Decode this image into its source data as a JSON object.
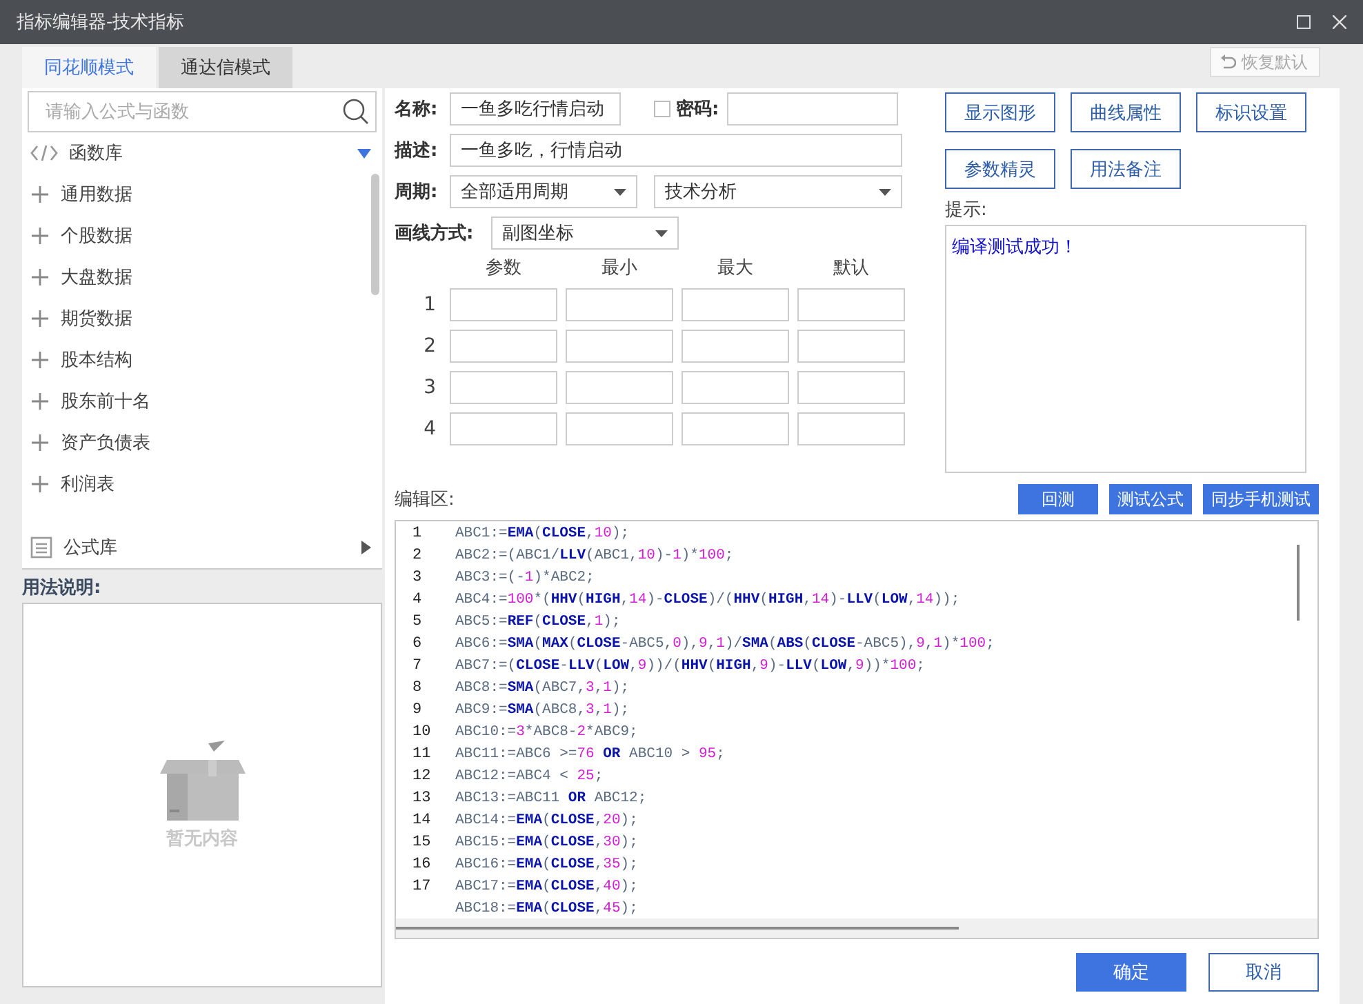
{
  "window": {
    "title": "指标编辑器-技术指标"
  },
  "tabs": [
    {
      "label": "同花顺模式",
      "selected": true
    },
    {
      "label": "通达信模式",
      "selected": false
    }
  ],
  "search": {
    "placeholder": "请输入公式与函数"
  },
  "libraries": [
    {
      "label": "函数库",
      "kind": "code",
      "expanded": true,
      "items": [
        {
          "label": "通用数据",
          "expanded": false
        },
        {
          "label": "个股数据",
          "expanded": false
        },
        {
          "label": "大盘数据",
          "expanded": false
        },
        {
          "label": "期货数据",
          "expanded": false
        },
        {
          "label": "股本结构",
          "expanded": false
        },
        {
          "label": "股东前十名",
          "expanded": false
        },
        {
          "label": "资产负债表",
          "expanded": false
        },
        {
          "label": "利润表",
          "expanded": false
        }
      ]
    },
    {
      "label": "公式库",
      "kind": "list",
      "expanded": false
    }
  ],
  "usage": {
    "label": "用法说明:",
    "empty_text": "暂无内容"
  },
  "restore_button": {
    "label": "恢复默认",
    "disabled": true
  },
  "form": {
    "name": {
      "label": "名称:",
      "value": "一鱼多吃行情启动"
    },
    "password": {
      "label": "密码:",
      "checked": false
    },
    "description": {
      "label": "描述:",
      "value": "一鱼多吃，行情启动"
    },
    "period": {
      "label": "周期:",
      "value": "全部适用周期"
    },
    "category": {
      "value": "技术分析"
    },
    "draw_mode": {
      "label": "画线方式:",
      "value": "副图坐标"
    }
  },
  "params": {
    "columns": [
      "参数",
      "最小",
      "最大",
      "默认"
    ],
    "rows": [
      "1",
      "2",
      "3",
      "4"
    ]
  },
  "side_buttons": [
    "显示图形",
    "曲线属性",
    "标识设置",
    "参数精灵",
    "用法备注"
  ],
  "hint": {
    "label": "提示:",
    "text": "编译测试成功！"
  },
  "editor": {
    "label": "编辑区:",
    "buttons": [
      "回测",
      "测试公式",
      "同步手机测试"
    ],
    "lines": [
      {
        "number": "1",
        "tokens": [
          {
            "text": "ABC1:=",
            "kind": "p"
          },
          {
            "text": "EMA",
            "kind": "f"
          },
          {
            "text": "(",
            "kind": "p"
          },
          {
            "text": "CLOSE",
            "kind": "f"
          },
          {
            "text": ",",
            "kind": "p"
          },
          {
            "text": "10",
            "kind": "n"
          },
          {
            "text": ");",
            "kind": "p"
          }
        ]
      },
      {
        "number": "2",
        "tokens": [
          {
            "text": "ABC2:=(ABC1/",
            "kind": "p"
          },
          {
            "text": "LLV",
            "kind": "f"
          },
          {
            "text": "(ABC1,",
            "kind": "p"
          },
          {
            "text": "10",
            "kind": "n"
          },
          {
            "text": ")-",
            "kind": "p"
          },
          {
            "text": "1",
            "kind": "n"
          },
          {
            "text": ")*",
            "kind": "p"
          },
          {
            "text": "100",
            "kind": "n"
          },
          {
            "text": ";",
            "kind": "p"
          }
        ]
      },
      {
        "number": "3",
        "tokens": [
          {
            "text": "ABC3:=(-",
            "kind": "p"
          },
          {
            "text": "1",
            "kind": "n"
          },
          {
            "text": ")*ABC2;",
            "kind": "p"
          }
        ]
      },
      {
        "number": "4",
        "tokens": [
          {
            "text": "ABC4:=",
            "kind": "p"
          },
          {
            "text": "100",
            "kind": "n"
          },
          {
            "text": "*(",
            "kind": "p"
          },
          {
            "text": "HHV",
            "kind": "f"
          },
          {
            "text": "(",
            "kind": "p"
          },
          {
            "text": "HIGH",
            "kind": "f"
          },
          {
            "text": ",",
            "kind": "p"
          },
          {
            "text": "14",
            "kind": "n"
          },
          {
            "text": ")-",
            "kind": "p"
          },
          {
            "text": "CLOSE",
            "kind": "f"
          },
          {
            "text": ")/(",
            "kind": "p"
          },
          {
            "text": "HHV",
            "kind": "f"
          },
          {
            "text": "(",
            "kind": "p"
          },
          {
            "text": "HIGH",
            "kind": "f"
          },
          {
            "text": ",",
            "kind": "p"
          },
          {
            "text": "14",
            "kind": "n"
          },
          {
            "text": ")-",
            "kind": "p"
          },
          {
            "text": "LLV",
            "kind": "f"
          },
          {
            "text": "(",
            "kind": "p"
          },
          {
            "text": "LOW",
            "kind": "f"
          },
          {
            "text": ",",
            "kind": "p"
          },
          {
            "text": "14",
            "kind": "n"
          },
          {
            "text": "));",
            "kind": "p"
          }
        ]
      },
      {
        "number": "5",
        "tokens": [
          {
            "text": "ABC5:=",
            "kind": "p"
          },
          {
            "text": "REF",
            "kind": "f"
          },
          {
            "text": "(",
            "kind": "p"
          },
          {
            "text": "CLOSE",
            "kind": "f"
          },
          {
            "text": ",",
            "kind": "p"
          },
          {
            "text": "1",
            "kind": "n"
          },
          {
            "text": ");",
            "kind": "p"
          }
        ]
      },
      {
        "number": "6",
        "tokens": [
          {
            "text": "ABC6:=",
            "kind": "p"
          },
          {
            "text": "SMA",
            "kind": "f"
          },
          {
            "text": "(",
            "kind": "p"
          },
          {
            "text": "MAX",
            "kind": "f"
          },
          {
            "text": "(",
            "kind": "p"
          },
          {
            "text": "CLOSE",
            "kind": "f"
          },
          {
            "text": "-ABC5,",
            "kind": "p"
          },
          {
            "text": "0",
            "kind": "n"
          },
          {
            "text": "),",
            "kind": "p"
          },
          {
            "text": "9",
            "kind": "n"
          },
          {
            "text": ",",
            "kind": "p"
          },
          {
            "text": "1",
            "kind": "n"
          },
          {
            "text": ")/",
            "kind": "p"
          },
          {
            "text": "SMA",
            "kind": "f"
          },
          {
            "text": "(",
            "kind": "p"
          },
          {
            "text": "ABS",
            "kind": "f"
          },
          {
            "text": "(",
            "kind": "p"
          },
          {
            "text": "CLOSE",
            "kind": "f"
          },
          {
            "text": "-ABC5),",
            "kind": "p"
          },
          {
            "text": "9",
            "kind": "n"
          },
          {
            "text": ",",
            "kind": "p"
          },
          {
            "text": "1",
            "kind": "n"
          },
          {
            "text": ")*",
            "kind": "p"
          },
          {
            "text": "100",
            "kind": "n"
          },
          {
            "text": ";",
            "kind": "p"
          }
        ]
      },
      {
        "number": "7",
        "tokens": [
          {
            "text": "ABC7:=(",
            "kind": "p"
          },
          {
            "text": "CLOSE",
            "kind": "f"
          },
          {
            "text": "-",
            "kind": "p"
          },
          {
            "text": "LLV",
            "kind": "f"
          },
          {
            "text": "(",
            "kind": "p"
          },
          {
            "text": "LOW",
            "kind": "f"
          },
          {
            "text": ",",
            "kind": "p"
          },
          {
            "text": "9",
            "kind": "n"
          },
          {
            "text": "))/(",
            "kind": "p"
          },
          {
            "text": "HHV",
            "kind": "f"
          },
          {
            "text": "(",
            "kind": "p"
          },
          {
            "text": "HIGH",
            "kind": "f"
          },
          {
            "text": ",",
            "kind": "p"
          },
          {
            "text": "9",
            "kind": "n"
          },
          {
            "text": ")-",
            "kind": "p"
          },
          {
            "text": "LLV",
            "kind": "f"
          },
          {
            "text": "(",
            "kind": "p"
          },
          {
            "text": "LOW",
            "kind": "f"
          },
          {
            "text": ",",
            "kind": "p"
          },
          {
            "text": "9",
            "kind": "n"
          },
          {
            "text": "))*",
            "kind": "p"
          },
          {
            "text": "100",
            "kind": "n"
          },
          {
            "text": ";",
            "kind": "p"
          }
        ]
      },
      {
        "number": "8",
        "tokens": [
          {
            "text": "ABC8:=",
            "kind": "p"
          },
          {
            "text": "SMA",
            "kind": "f"
          },
          {
            "text": "(ABC7,",
            "kind": "p"
          },
          {
            "text": "3",
            "kind": "n"
          },
          {
            "text": ",",
            "kind": "p"
          },
          {
            "text": "1",
            "kind": "n"
          },
          {
            "text": ");",
            "kind": "p"
          }
        ]
      },
      {
        "number": "9",
        "tokens": [
          {
            "text": "ABC9:=",
            "kind": "p"
          },
          {
            "text": "SMA",
            "kind": "f"
          },
          {
            "text": "(ABC8,",
            "kind": "p"
          },
          {
            "text": "3",
            "kind": "n"
          },
          {
            "text": ",",
            "kind": "p"
          },
          {
            "text": "1",
            "kind": "n"
          },
          {
            "text": ");",
            "kind": "p"
          }
        ]
      },
      {
        "number": "10",
        "tokens": [
          {
            "text": "ABC10:=",
            "kind": "p"
          },
          {
            "text": "3",
            "kind": "n"
          },
          {
            "text": "*ABC8-",
            "kind": "p"
          },
          {
            "text": "2",
            "kind": "n"
          },
          {
            "text": "*ABC9;",
            "kind": "p"
          }
        ]
      },
      {
        "number": "11",
        "tokens": [
          {
            "text": "ABC11:=ABC6 >=",
            "kind": "p"
          },
          {
            "text": "76",
            "kind": "n"
          },
          {
            "text": " OR",
            "kind": "f"
          },
          {
            "text": " ABC10 > ",
            "kind": "p"
          },
          {
            "text": "95",
            "kind": "n"
          },
          {
            "text": ";",
            "kind": "p"
          }
        ]
      },
      {
        "number": "12",
        "tokens": [
          {
            "text": "ABC12:=ABC4 < ",
            "kind": "p"
          },
          {
            "text": "25",
            "kind": "n"
          },
          {
            "text": ";",
            "kind": "p"
          }
        ]
      },
      {
        "number": "13",
        "tokens": [
          {
            "text": "ABC13:=ABC11 ",
            "kind": "p"
          },
          {
            "text": "OR",
            "kind": "f"
          },
          {
            "text": " ABC12;",
            "kind": "p"
          }
        ]
      },
      {
        "number": "14",
        "tokens": [
          {
            "text": "ABC14:=",
            "kind": "p"
          },
          {
            "text": "EMA",
            "kind": "f"
          },
          {
            "text": "(",
            "kind": "p"
          },
          {
            "text": "CLOSE",
            "kind": "f"
          },
          {
            "text": ",",
            "kind": "p"
          },
          {
            "text": "20",
            "kind": "n"
          },
          {
            "text": ");",
            "kind": "p"
          }
        ]
      },
      {
        "number": "15",
        "tokens": [
          {
            "text": "ABC15:=",
            "kind": "p"
          },
          {
            "text": "EMA",
            "kind": "f"
          },
          {
            "text": "(",
            "kind": "p"
          },
          {
            "text": "CLOSE",
            "kind": "f"
          },
          {
            "text": ",",
            "kind": "p"
          },
          {
            "text": "30",
            "kind": "n"
          },
          {
            "text": ");",
            "kind": "p"
          }
        ]
      },
      {
        "number": "16",
        "tokens": [
          {
            "text": "ABC16:=",
            "kind": "p"
          },
          {
            "text": "EMA",
            "kind": "f"
          },
          {
            "text": "(",
            "kind": "p"
          },
          {
            "text": "CLOSE",
            "kind": "f"
          },
          {
            "text": ",",
            "kind": "p"
          },
          {
            "text": "35",
            "kind": "n"
          },
          {
            "text": ");",
            "kind": "p"
          }
        ]
      },
      {
        "number": "17",
        "tokens": [
          {
            "text": "ABC17:=",
            "kind": "p"
          },
          {
            "text": "EMA",
            "kind": "f"
          },
          {
            "text": "(",
            "kind": "p"
          },
          {
            "text": "CLOSE",
            "kind": "f"
          },
          {
            "text": ",",
            "kind": "p"
          },
          {
            "text": "40",
            "kind": "n"
          },
          {
            "text": ");",
            "kind": "p"
          }
        ]
      },
      {
        "tokens": [
          {
            "text": "ABC18:=",
            "kind": "p"
          },
          {
            "text": "EMA",
            "kind": "f"
          },
          {
            "text": "(",
            "kind": "p"
          },
          {
            "text": "CLOSE",
            "kind": "f"
          },
          {
            "text": ",",
            "kind": "p"
          },
          {
            "text": "45",
            "kind": "n"
          },
          {
            "text": ");",
            "kind": "p"
          }
        ]
      }
    ]
  },
  "footer_buttons": [
    {
      "label": "确定",
      "kind": "primary"
    },
    {
      "label": "取消",
      "kind": "secondary"
    }
  ]
}
